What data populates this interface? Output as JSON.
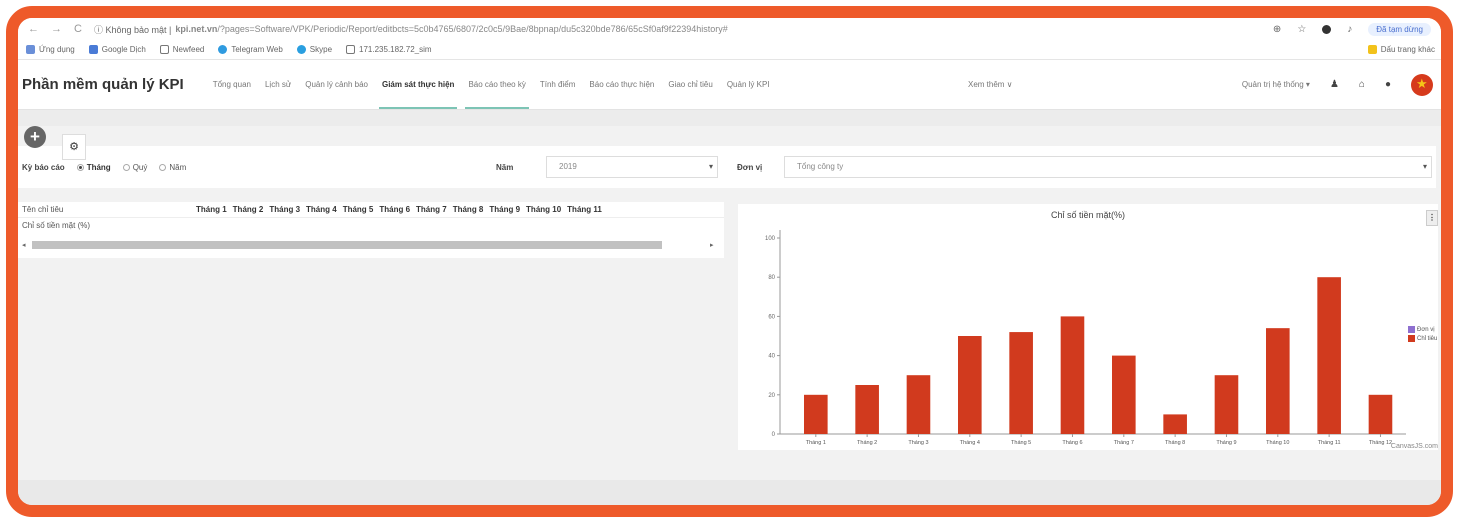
{
  "browser": {
    "info": "Không bảo mật",
    "url_domain": "kpi.net.vn",
    "url_path": "/?pages=Software/VPK/Periodic/Report/editbcts=5c0b4765/6807/2c0c5/9Bae/8bpnap/du5c320bde786/65cSf0af9f22394history#",
    "sync": "Đã tạm dừng",
    "bookmarks": [
      "Ứng dụng",
      "Google Dịch",
      "Newfeed",
      "Telegram Web",
      "Skype",
      "171.235.182.72_sim"
    ],
    "bookmark_right": "Dấu trang khác"
  },
  "app": {
    "brand": "Phần mềm quản lý KPI",
    "menu": [
      "Tổng quan",
      "Lịch sử",
      "Quản lý cảnh báo",
      "Giám sát thực hiện",
      "Báo cáo theo kỳ",
      "Tính điểm",
      "Báo cáo thực hiện",
      "Giao chỉ tiêu",
      "Quản lý KPI"
    ],
    "more": "Xem thêm ∨",
    "admin": "Quản trị hệ thống ▾"
  },
  "filters": {
    "period_label": "Kỳ báo cáo",
    "periods": [
      "Tháng",
      "Quý",
      "Năm"
    ],
    "year_label": "Năm",
    "year_value": "2019",
    "unit_label": "Đơn vị",
    "unit_value": "Tổng công ty"
  },
  "table": {
    "name_header": "Tên chỉ tiêu",
    "months": [
      "Tháng 1",
      "Tháng 2",
      "Tháng 3",
      "Tháng 4",
      "Tháng 5",
      "Tháng 6",
      "Tháng 7",
      "Tháng 8",
      "Tháng 9",
      "Tháng 10",
      "Tháng 11"
    ],
    "rows": [
      "Chỉ số tiền mặt (%)"
    ]
  },
  "chart_data": {
    "type": "bar",
    "title": "Chỉ số tiền mặt(%)",
    "categories": [
      "Tháng 1",
      "Tháng 2",
      "Tháng 3",
      "Tháng 4",
      "Tháng 5",
      "Tháng 6",
      "Tháng 7",
      "Tháng 8",
      "Tháng 9",
      "Tháng 10",
      "Tháng 11",
      "Tháng 12"
    ],
    "series": [
      {
        "name": "Chỉ tiêu",
        "color": "#d13a1e",
        "values": [
          20,
          25,
          30,
          50,
          52,
          60,
          40,
          10,
          30,
          54,
          80,
          20
        ]
      }
    ],
    "legend": [
      {
        "name": "Đơn vị",
        "color": "#8e6fd0"
      },
      {
        "name": "Chỉ tiêu",
        "color": "#d13a1e"
      }
    ],
    "yticks": [
      0,
      20,
      40,
      60,
      80,
      100
    ],
    "ylim": [
      0,
      100
    ],
    "legend_position": "right",
    "credit": "CanvasJS.com"
  }
}
